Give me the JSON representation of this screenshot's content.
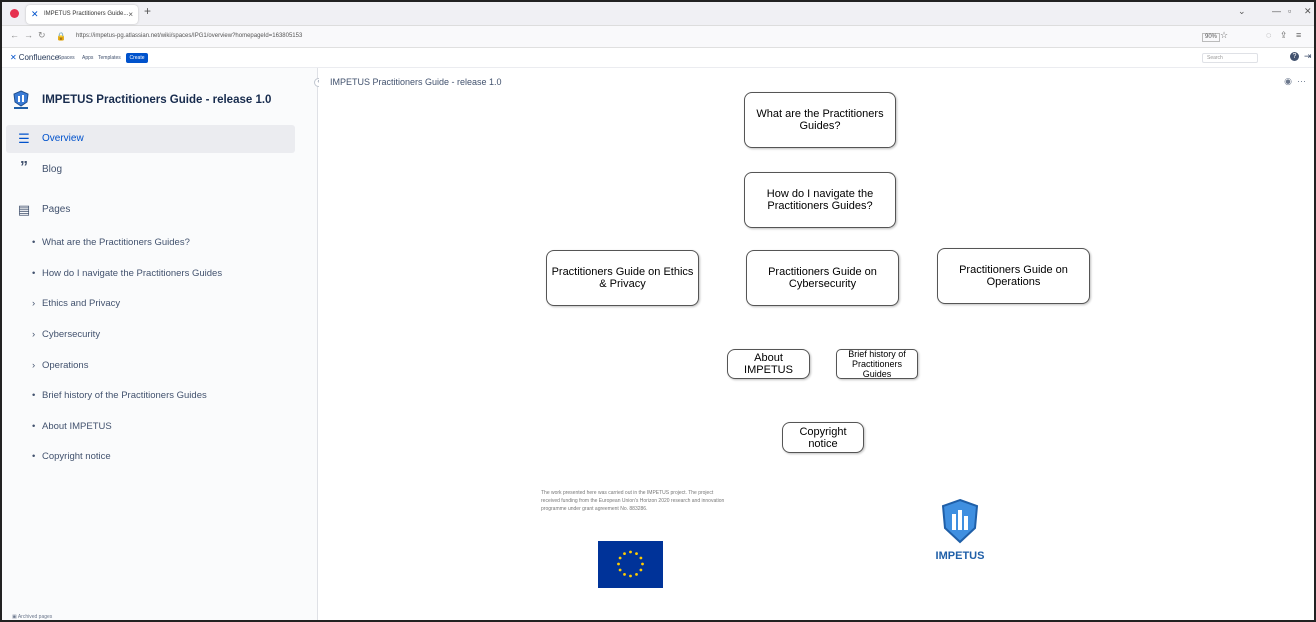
{
  "browser": {
    "tab_title": "IMPETUS Practitioners Guide...",
    "tab_close": "×",
    "new_tab": "+",
    "url": "https://impetus-pg.atlassian.net/wiki/spaces/IPG1/overview?homepageId=163805153",
    "zoom": "90%"
  },
  "header": {
    "product": "Confluence",
    "menus": [
      "Spaces",
      "Apps",
      "Templates"
    ],
    "create_label": "Create",
    "search_placeholder": "Search"
  },
  "sidebar": {
    "space_title": "IMPETUS Practitioners Guide - release 1.0",
    "nav": [
      {
        "label": "Overview",
        "icon": "overview-icon"
      },
      {
        "label": "Blog",
        "icon": "quote-icon"
      },
      {
        "label": "Pages",
        "icon": "pages-icon"
      }
    ],
    "pages": [
      {
        "label": "What are the Practitioners Guides?",
        "mark": "•"
      },
      {
        "label": "How do I navigate the Practitioners Guides",
        "mark": "•"
      },
      {
        "label": "Ethics and Privacy",
        "mark": "›"
      },
      {
        "label": "Cybersecurity",
        "mark": "›"
      },
      {
        "label": "Operations",
        "mark": "›"
      },
      {
        "label": "Brief history of the Practitioners Guides",
        "mark": "•"
      },
      {
        "label": "About IMPETUS",
        "mark": "•"
      },
      {
        "label": "Copyright notice",
        "mark": "•"
      }
    ],
    "archived_label": "Archived pages"
  },
  "main": {
    "breadcrumb": "IMPETUS Practitioners Guide - release 1.0",
    "boxes": {
      "what_are": "What are the Practitioners Guides?",
      "navigate": "How do I navigate the Practitioners Guides?",
      "ethics": "Practitioners Guide on Ethics & Privacy",
      "cyber": "Practitioners Guide on Cybersecurity",
      "operations": "Practitioners Guide on Operations",
      "about": "About IMPETUS",
      "history": "Brief history of Practitioners Guides",
      "copyright": "Copyright notice"
    },
    "funding_text": "The work presented here was carried out in the IMPETUS project. The project received funding from the European Union's Horizon 2020 research and innovation programme under grant agreement No. 883286.",
    "logo_text": "IMPETUS"
  }
}
